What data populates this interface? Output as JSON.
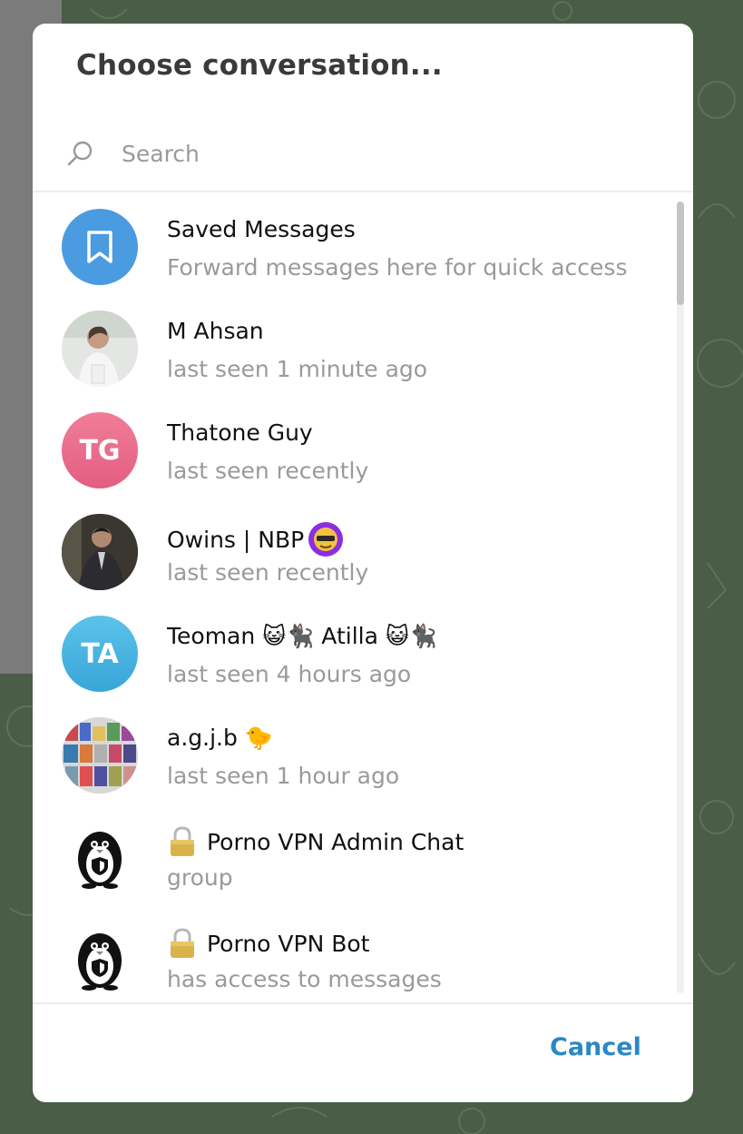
{
  "dialog": {
    "title": "Choose conversation...",
    "search_placeholder": "Search",
    "cancel_label": "Cancel"
  },
  "colors": {
    "accent": "#2a88c8",
    "saved_messages_avatar": "#4a9be0",
    "avatar_tg": "#e96d8d",
    "avatar_ta": "#45b1de"
  },
  "chats": [
    {
      "name": "Saved Messages",
      "status": "Forward messages here for quick access",
      "avatar": "bookmark-icon"
    },
    {
      "name": "M Ahsan",
      "status": "last seen 1 minute ago",
      "avatar": "photo"
    },
    {
      "name": "Thatone Guy",
      "status": "last seen recently",
      "initials": "TG"
    },
    {
      "name": "Owins | NBP",
      "status": "last seen recently",
      "avatar": "photo",
      "badge": "premium-emoji-icon"
    },
    {
      "name": "Teoman 😺🐈‍⬛ Atilla 😺🐈‍⬛",
      "status": "last seen 4 hours ago",
      "initials": "TA"
    },
    {
      "name": "a.g.j.b 🐤",
      "status": "last seen 1 hour ago",
      "avatar": "photo"
    },
    {
      "name": "Porno VPN Admin Chat",
      "status": "group",
      "avatar": "penguin-icon",
      "prefix_icon": "lock-icon"
    },
    {
      "name": "Porno VPN Bot",
      "status": "has access to messages",
      "avatar": "penguin-icon",
      "prefix_icon": "lock-icon"
    }
  ]
}
